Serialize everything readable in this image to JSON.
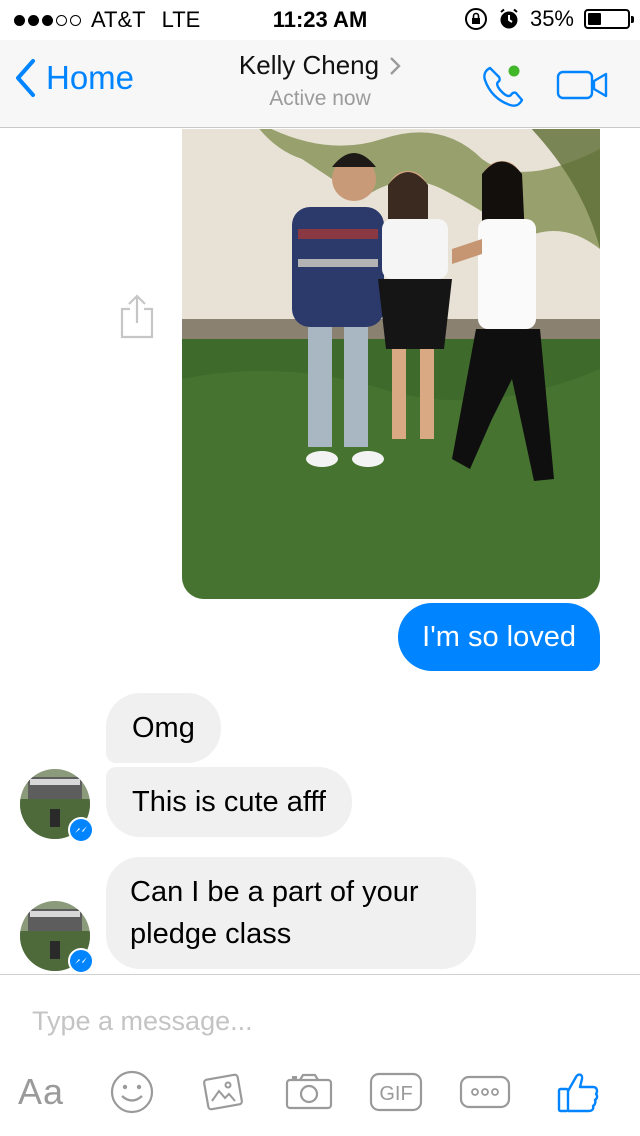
{
  "status_bar": {
    "carrier": "AT&T",
    "network": "LTE",
    "time": "11:23 AM",
    "battery": "35%",
    "battery_level": 0.35,
    "signal_bars": 3
  },
  "nav": {
    "back_label": "Home",
    "contact_name": "Kelly Cheng",
    "status": "Active now",
    "accent_color": "#0084ff",
    "online_dot_color": "#42b72a"
  },
  "messages": {
    "sent_1": "I'm so loved",
    "received_1": "Omg",
    "received_2": "This is cute afff",
    "received_3_line1": "Can I be a part of your",
    "received_3_line2": "pledge class"
  },
  "composer": {
    "placeholder": "Type a message...",
    "text_button": "Aa",
    "gif_label": "GIF"
  },
  "colors": {
    "outgoing_bubble": "#0084ff",
    "incoming_bubble": "#f1f0f0"
  }
}
